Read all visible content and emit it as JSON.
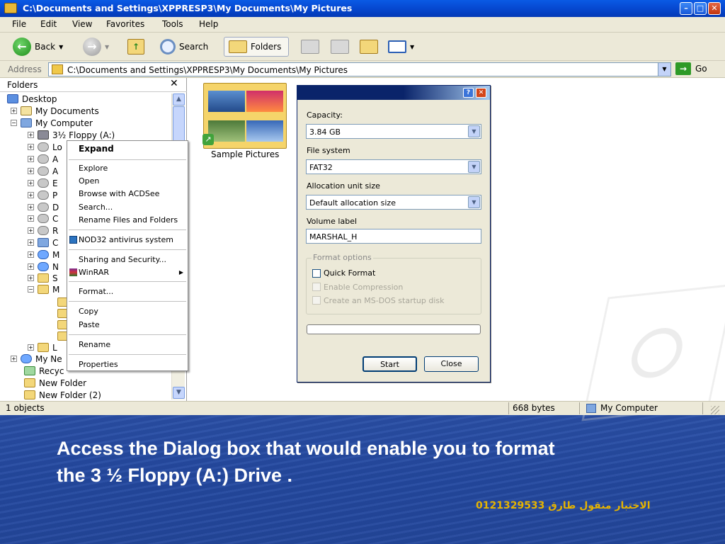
{
  "window": {
    "title": "C:\\Documents and Settings\\XPPRESP3\\My Documents\\My Pictures",
    "minimize": "–",
    "maximize": "□",
    "close": "✕"
  },
  "menu": [
    "File",
    "Edit",
    "View",
    "Favorites",
    "Tools",
    "Help"
  ],
  "toolbar": {
    "back": "Back",
    "search": "Search",
    "folders": "Folders"
  },
  "address": {
    "label": "Address",
    "value": "C:\\Documents and Settings\\XPPRESP3\\My Documents\\My Pictures",
    "go": "Go"
  },
  "folders_pane": {
    "title": "Folders",
    "close": "✕",
    "tree": [
      {
        "label": "Desktop"
      },
      {
        "label": "My Documents"
      },
      {
        "label": "My Computer"
      },
      {
        "label": "3½ Floppy (A:)"
      },
      {
        "label": "Lo"
      },
      {
        "label": "A"
      },
      {
        "label": "A"
      },
      {
        "label": "E"
      },
      {
        "label": "P"
      },
      {
        "label": "D"
      },
      {
        "label": "C"
      },
      {
        "label": "R"
      },
      {
        "label": "C"
      },
      {
        "label": "M"
      },
      {
        "label": "N"
      },
      {
        "label": "S"
      },
      {
        "label": "M"
      },
      {
        "label": "L"
      },
      {
        "label": "My Ne"
      },
      {
        "label": "Recyc"
      },
      {
        "label": "New Folder"
      },
      {
        "label": "New Folder (2)"
      }
    ]
  },
  "context_menu": {
    "items": [
      "Expand",
      "Explore",
      "Open",
      "Browse with ACDSee",
      "Search...",
      "Rename Files and Folders",
      "NOD32 antivirus system",
      "Sharing and Security...",
      "WinRAR",
      "Format...",
      "Copy",
      "Paste",
      "Rename",
      "Properties"
    ],
    "submenu_arrow": "▶"
  },
  "content": {
    "thumbnail_label": "Sample Pictures"
  },
  "format_dialog": {
    "help": "?",
    "close": "✕",
    "capacity_label": "Capacity:",
    "capacity_value": "3.84 GB",
    "fs_label": "File system",
    "fs_value": "FAT32",
    "alloc_label": "Allocation unit size",
    "alloc_value": "Default allocation size",
    "volume_label": "Volume label",
    "volume_value": "MARSHAL_H",
    "options_title": "Format options",
    "opt_quick": "Quick Format",
    "opt_compress": "Enable Compression",
    "opt_msdos": "Create an MS-DOS startup disk",
    "start": "Start",
    "close_btn": "Close",
    "progress": 0
  },
  "statusbar": {
    "objects": "1 objects",
    "size": "668 bytes",
    "location": "My Computer"
  },
  "slide": {
    "caption_line1": "Access the Dialog box that would enable you to format",
    "caption_line2": "the 3 ½  Floppy (A:) Drive .",
    "footer": "الاختبار منقول طارق 0121329533"
  },
  "colors": {
    "titlebar": "#0648d0",
    "slide_bg": "#2449a0",
    "footer_text": "#e6b400"
  }
}
